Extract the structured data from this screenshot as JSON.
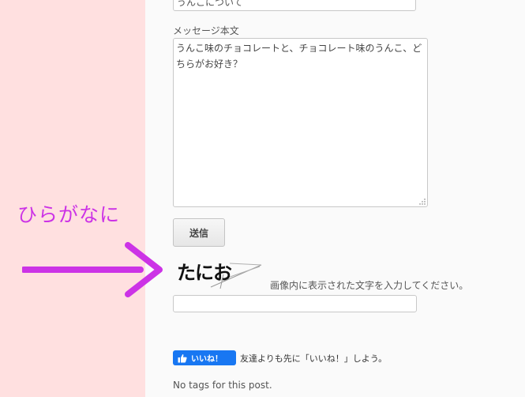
{
  "colors": {
    "sidebar_bg": "#ffe0e0",
    "content_bg": "#fafafa",
    "annotation": "#cc33e6",
    "fb_blue": "#1877f2"
  },
  "form": {
    "subject_value": "うんこについて",
    "message_label": "メッセージ本文",
    "message_value": "うんこ味のチョコレートと、チョコレート味のうんこ、どちらがお好き？",
    "submit_label": "送信",
    "captcha_text": "たにお",
    "captcha_instruction": "画像内に表示された文字を入力してください。",
    "captcha_value": ""
  },
  "annotation": {
    "text": "ひらがなに",
    "arrow_icon": "right-arrow-icon"
  },
  "facebook": {
    "like_label": "いいね！",
    "like_text": "友達よりも先に「いいね！」しよう。",
    "icon": "thumbs-up-icon"
  },
  "footer": {
    "tags_text": "No tags for this post."
  }
}
